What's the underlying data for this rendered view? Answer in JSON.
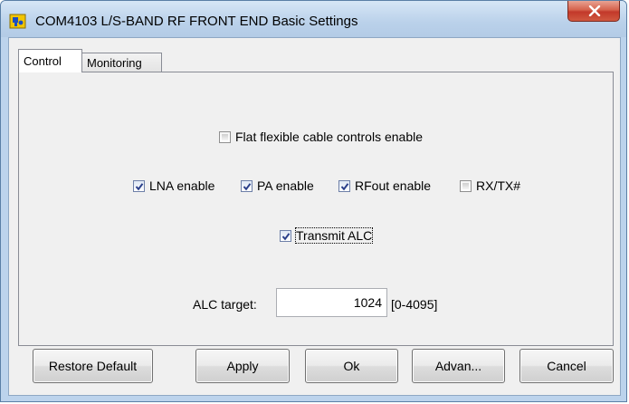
{
  "window": {
    "title": "COM4103 L/S-BAND RF FRONT END Basic Settings"
  },
  "tabs": [
    {
      "label": "Control",
      "active": true
    },
    {
      "label": "Monitoring",
      "active": false
    }
  ],
  "control": {
    "flat_cable": {
      "label": "Flat flexible cable controls enable",
      "checked": false
    },
    "lna": {
      "label": "LNA enable",
      "checked": true
    },
    "pa": {
      "label": "PA enable",
      "checked": true
    },
    "rfout": {
      "label": "RFout enable",
      "checked": true
    },
    "rxtx": {
      "label": "RX/TX#",
      "checked": false
    },
    "transmit_alc": {
      "label": "Transmit ALC",
      "checked": true
    },
    "alc_target": {
      "label": "ALC target:",
      "value": "1024",
      "range": "[0-4095]"
    }
  },
  "buttons": {
    "restore": "Restore Default",
    "apply": "Apply",
    "ok": "Ok",
    "advanced": "Advan...",
    "cancel": "Cancel"
  },
  "icons": {
    "app": "puzzle-icon",
    "close": "close-icon",
    "check": "checkmark-icon"
  },
  "colors": {
    "title_bar": "#bcd3ec",
    "close_button": "#c9462f",
    "dialog_bg": "#f0f0f0"
  }
}
